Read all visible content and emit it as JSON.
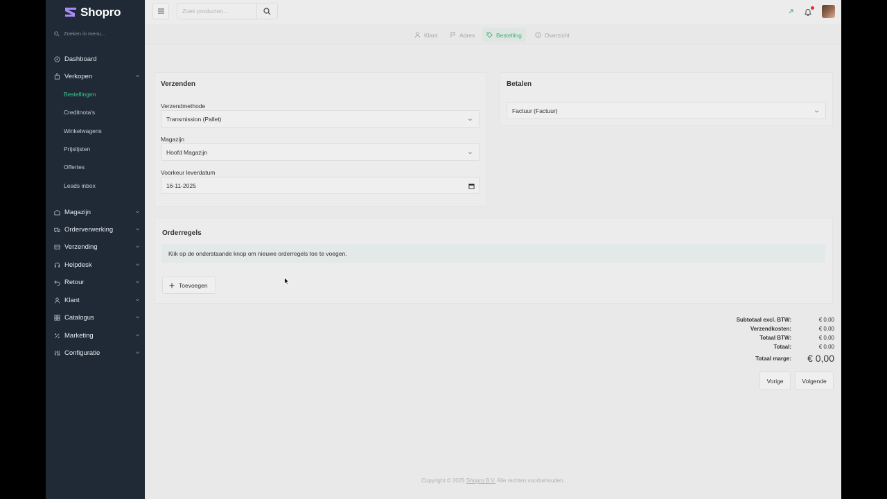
{
  "brand": {
    "name": "Shopro",
    "accent": "#3fc48a",
    "logo_color": "#a78bfa"
  },
  "sidebar": {
    "search_placeholder": "Zoeken in menu...",
    "items": [
      {
        "label": "Dashboard",
        "icon": "dashboard-icon"
      },
      {
        "label": "Verkopen",
        "icon": "shopping-bag-icon",
        "expanded": true
      },
      {
        "label": "Magazijn",
        "icon": "warehouse-icon"
      },
      {
        "label": "Orderverwerking",
        "icon": "truck-icon"
      },
      {
        "label": "Verzending",
        "icon": "shipping-icon"
      },
      {
        "label": "Helpdesk",
        "icon": "headset-icon"
      },
      {
        "label": "Retour",
        "icon": "return-icon"
      },
      {
        "label": "Klant",
        "icon": "user-icon"
      },
      {
        "label": "Catalogus",
        "icon": "catalog-icon"
      },
      {
        "label": "Marketing",
        "icon": "percent-icon"
      },
      {
        "label": "Configuratie",
        "icon": "settings-icon"
      }
    ],
    "sub_items": [
      {
        "label": "Bestellingen",
        "active": true
      },
      {
        "label": "Creditnota's"
      },
      {
        "label": "Winkelwagens"
      },
      {
        "label": "Prijslijsten"
      },
      {
        "label": "Offertes"
      },
      {
        "label": "Leads inbox"
      }
    ]
  },
  "topbar": {
    "search_placeholder": "Zoek producten..."
  },
  "steps": [
    {
      "label": "Klant",
      "icon": "user-icon"
    },
    {
      "label": "Adres",
      "icon": "flag-icon"
    },
    {
      "label": "Bestelling",
      "icon": "tag-icon",
      "active": true
    },
    {
      "label": "Overzicht",
      "icon": "info-icon"
    }
  ],
  "shipping": {
    "title": "Verzenden",
    "method_label": "Verzendmethode",
    "method_value": "Transmission (Pallet)",
    "warehouse_label": "Magazijn",
    "warehouse_value": "Hoofd Magazijn",
    "date_label": "Voorkeur leverdatum",
    "date_value": "16-11-2025"
  },
  "payment": {
    "title": "Betalen",
    "method_value": "Factuur (Factuur)"
  },
  "orderlines": {
    "title": "Orderregels",
    "info": "Klik op de onderstaande knop om nieuwe orderregels toe te voegen.",
    "add_label": "Toevoegen"
  },
  "totals": [
    {
      "label": "Subtotaal excl. BTW:",
      "value": "€ 0,00"
    },
    {
      "label": "Verzendkosten:",
      "value": "€ 0,00"
    },
    {
      "label": "Totaal BTW:",
      "value": "€ 0,00"
    },
    {
      "label": "Totaal:",
      "value": "€ 0,00"
    },
    {
      "label": "Totaal marge:",
      "value": "€ 0,00"
    }
  ],
  "actions": {
    "prev": "Vorige",
    "next": "Volgende"
  },
  "footer": {
    "prefix": "Copyright © 2025 ",
    "link": "Shopro B.V.",
    "suffix": " Alle rechten voorbehouden."
  }
}
